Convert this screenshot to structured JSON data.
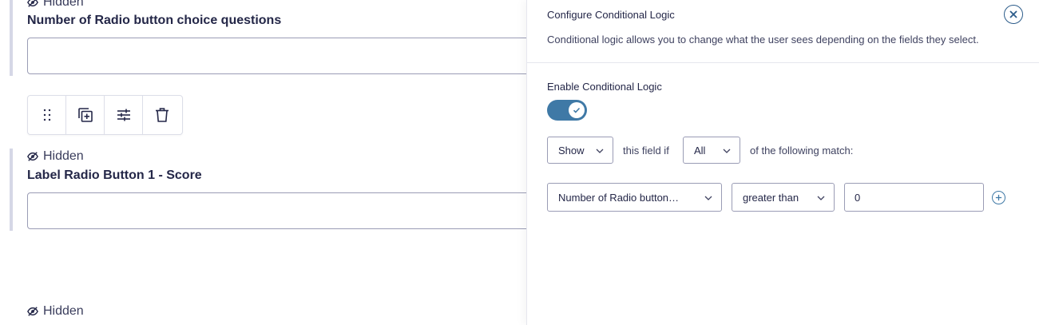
{
  "form": {
    "fields": [
      {
        "visibility": "Hidden",
        "label": "Number of Radio button choice questions",
        "value": ""
      },
      {
        "visibility": "Hidden",
        "label": "Label Radio Button 1 - Score",
        "value": ""
      },
      {
        "visibility": "Hidden"
      }
    ],
    "toolbar": {
      "icons": [
        "drag-handle-icon",
        "duplicate-icon",
        "settings-sliders-icon",
        "trash-icon"
      ]
    }
  },
  "panel": {
    "title": "Configure Conditional Logic",
    "description": "Conditional logic allows you to change what the user sees depending on the fields they select.",
    "enable_label": "Enable Conditional Logic",
    "enabled": true,
    "action_select": "Show",
    "text_this_field_if": "this field if",
    "match_select": "All",
    "text_following_match": "of the following match:",
    "rule": {
      "field": "Number of Radio button…",
      "operator": "greater than",
      "value": "0"
    }
  },
  "colors": {
    "accent": "#3f79a6",
    "close": "#2c5c8a",
    "text": "#242748",
    "border": "#9a9cb5"
  }
}
